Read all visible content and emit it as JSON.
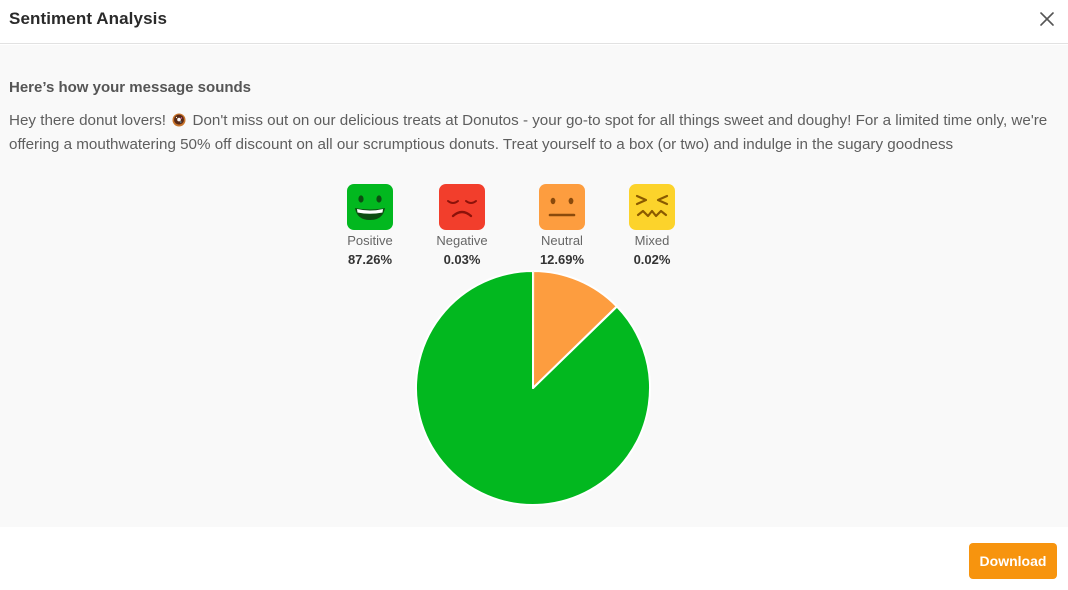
{
  "dialog": {
    "title": "Sentiment Analysis",
    "close_icon": "close-icon"
  },
  "content": {
    "subtitle": "Here’s how your message sounds",
    "message_before_emoji": "Hey there donut lovers!",
    "emoji_icon": "donut-icon",
    "message_after_emoji": "Don't miss out on our delicious treats at Donutos - your go-to spot for all things sweet and doughy! For a limited time only, we're offering a mouthwatering 50% off discount on all our scrumptious donuts. Treat yourself to a box (or two) and indulge in the sugary goodness"
  },
  "sentiments": [
    {
      "label": "Positive",
      "value": "87.26%",
      "icon": "grinning-face-icon",
      "color": "#02b81f"
    },
    {
      "label": "Negative",
      "value": "0.03%",
      "icon": "frowning-face-icon",
      "color": "#f23e2c"
    },
    {
      "label": "Neutral",
      "value": "12.69%",
      "icon": "neutral-face-icon",
      "color": "#fd9d3f"
    },
    {
      "label": "Mixed",
      "value": "0.02%",
      "icon": "confounded-face-icon",
      "color": "#fcd32b"
    }
  ],
  "chart_data": {
    "type": "pie",
    "categories": [
      "Positive",
      "Negative",
      "Neutral",
      "Mixed"
    ],
    "values": [
      87.26,
      0.03,
      12.69,
      0.02
    ],
    "colors": [
      "#02b81f",
      "#f23e2c",
      "#fd9d3f",
      "#fcd32b"
    ]
  },
  "footer": {
    "download_label": "Download"
  }
}
